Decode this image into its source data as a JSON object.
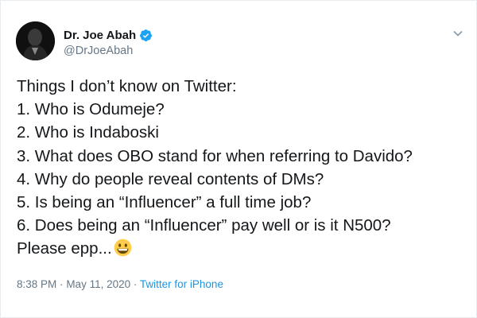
{
  "author": {
    "display_name": "Dr. Joe Abah",
    "handle": "@DrJoeAbah",
    "verified_icon": "verified-badge-icon",
    "avatar_icon": "profile-avatar"
  },
  "menu": {
    "icon": "chevron-down-icon"
  },
  "tweet": {
    "lines": [
      "Things I don’t know on Twitter:",
      "1. Who is Odumeje?",
      "2. Who is Indaboski",
      "3. What does OBO stand for when referring to Davido?",
      "4. Why do people reveal contents of DMs?",
      "5. Is being an “Influencer” a full time job?",
      "6. Does being an “Influencer” pay well or is it N500?",
      "Please epp..."
    ],
    "emoji_icon": "grinning-face-emoji"
  },
  "meta": {
    "time": "8:38 PM",
    "separator": "·",
    "date": "May 11, 2020",
    "source": "Twitter for iPhone"
  },
  "colors": {
    "text": "#14171a",
    "secondary": "#657786",
    "link": "#1b95e0",
    "verified": "#1da1f2",
    "border": "#e6ecf0"
  }
}
